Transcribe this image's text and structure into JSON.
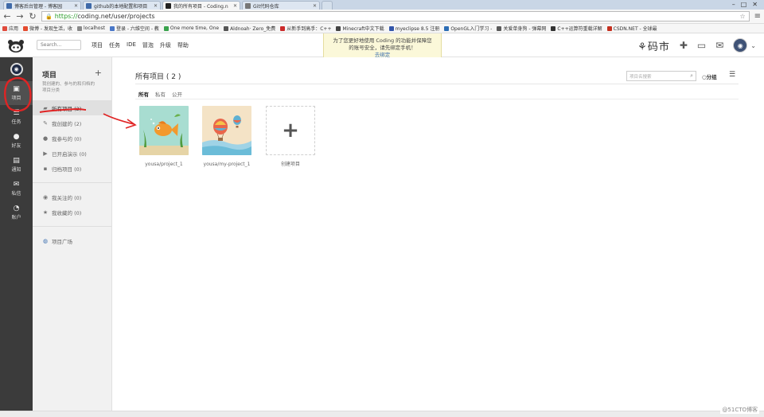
{
  "browser": {
    "tabs": [
      {
        "label": "博客后台管理 - 博客园",
        "color": "#3f6aa9"
      },
      {
        "label": "github的本地配置和项目",
        "color": "#3f6aa9"
      },
      {
        "label": "我的所有项目 - Coding.n",
        "color": "#222222",
        "active": true
      },
      {
        "label": "Git代码仓库",
        "color": "#777777"
      }
    ],
    "window_controls": {
      "min": "–",
      "max": "□",
      "close": "✕"
    },
    "url_https": "https://",
    "url_rest": "coding.net/user/projects",
    "bookmarks": [
      {
        "label": "应用",
        "color": "#e04b3c"
      },
      {
        "label": "微博 - 发现生活，收",
        "color": "#e44b2f"
      },
      {
        "label": "localhost",
        "color": "#8a8a8a"
      },
      {
        "label": "登录 - 六维空间 - 教",
        "color": "#4a78c8"
      },
      {
        "label": "One more time, One",
        "color": "#3aa34d"
      },
      {
        "label": "Aldnoah· Zero_免费",
        "color": "#555555"
      },
      {
        "label": "从新手到高手：C++",
        "color": "#cc2b2b"
      },
      {
        "label": "Minecraft中文下载",
        "color": "#444444"
      },
      {
        "label": "myeclipse 8.5 注册",
        "color": "#3355aa"
      },
      {
        "label": "OpenGL入门学习 - ",
        "color": "#2c6db5"
      },
      {
        "label": "关爱单身狗 - 弹幕网",
        "color": "#5a5a5a"
      },
      {
        "label": "C++运算符重载详解",
        "color": "#333333"
      },
      {
        "label": "CSDN.NET - 全球最",
        "color": "#c5301f"
      }
    ]
  },
  "topbar": {
    "search_placeholder": "Search...",
    "nav": [
      "项目",
      "任务",
      "IDE",
      "冒泡",
      "升级",
      "帮助"
    ],
    "notice_line1": "为了您更好地使用 Coding 的功能并保障您",
    "notice_line2": "的账号安全，请先绑定手机！",
    "notice_link": "去绑定",
    "brand": "码市"
  },
  "leftbar": {
    "items": [
      {
        "label": "项目",
        "icon": "folder-icon"
      },
      {
        "label": "任务",
        "icon": "tasks-icon"
      },
      {
        "label": "好友",
        "icon": "user-icon"
      },
      {
        "label": "通知",
        "icon": "inbox-icon"
      },
      {
        "label": "私信",
        "icon": "mail-icon"
      },
      {
        "label": "账户",
        "icon": "dashboard-icon"
      }
    ]
  },
  "panel": {
    "title": "项目",
    "desc": "我创建的、参与的和归档的项目分类",
    "items": [
      {
        "label": "所有项目 (2)"
      },
      {
        "label": "我创建的 (2)"
      },
      {
        "label": "我参与的 (0)"
      },
      {
        "label": "已开启演示 (0)"
      },
      {
        "label": "归档项目 (0)"
      }
    ],
    "items2": [
      {
        "label": "我关注的 (0)"
      },
      {
        "label": "我收藏的 (0)"
      }
    ],
    "square": "项目广场"
  },
  "main": {
    "title": "所有项目 ( 2 )",
    "search_placeholder": "项目名搜索",
    "group_label": "分组",
    "tabs": [
      "所有",
      "私有",
      "公开"
    ],
    "projects": [
      {
        "name": "yousa/project_1"
      },
      {
        "name": "yousa/my-project_1"
      }
    ],
    "create_label": "创建项目",
    "create_glyph": "+"
  },
  "watermark": "@51CTO博客"
}
